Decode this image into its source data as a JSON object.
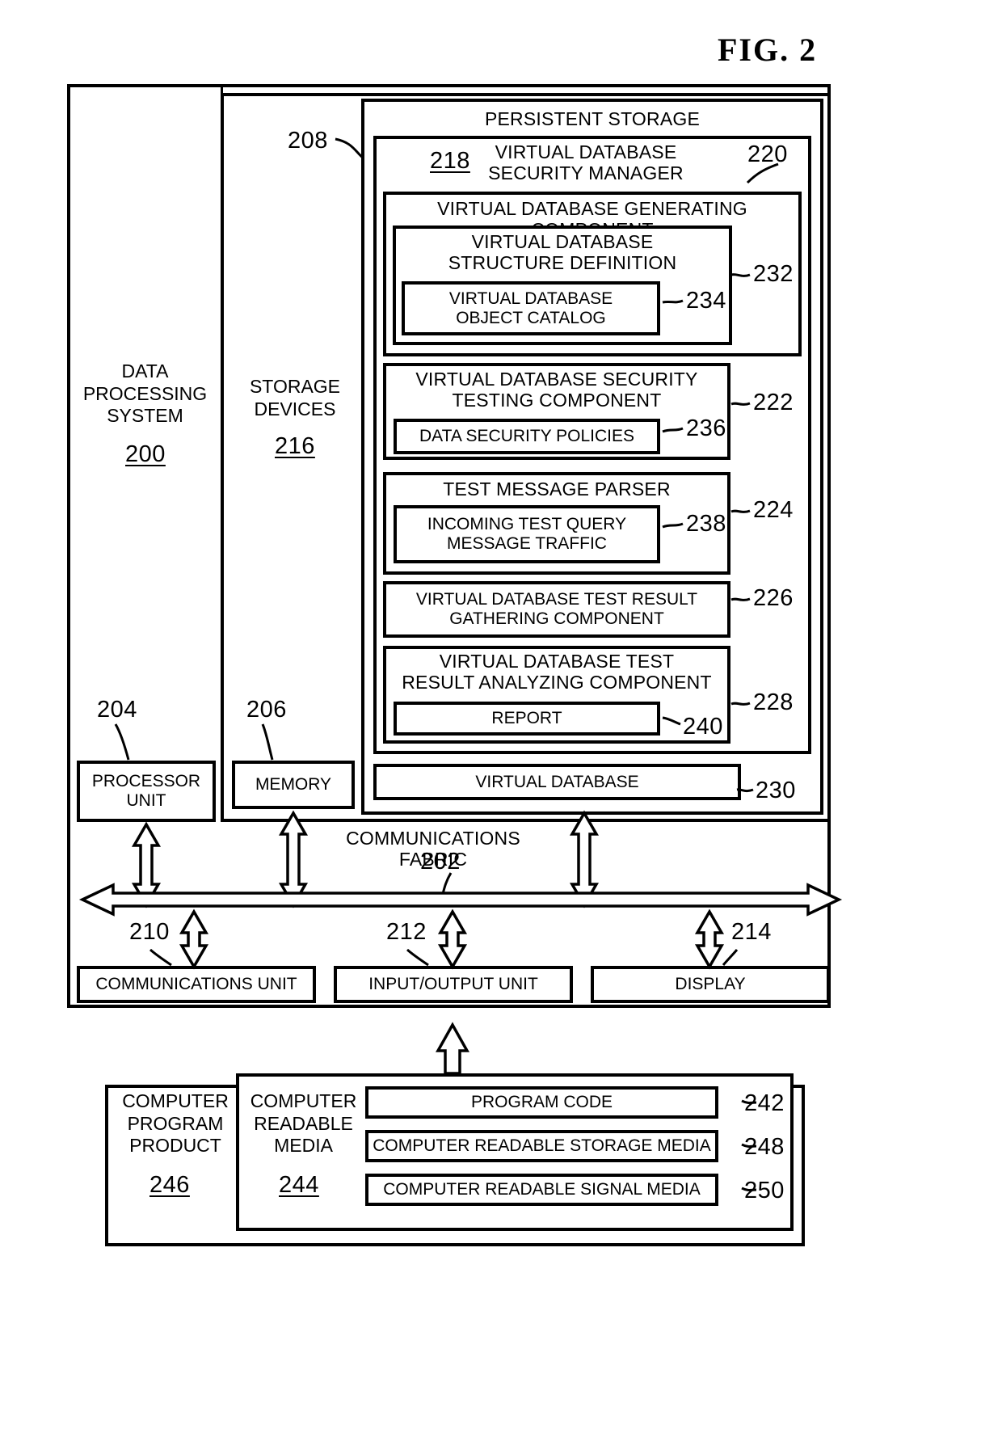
{
  "figure": {
    "title": "FIG. 2"
  },
  "system": {
    "name": "DATA\nPROCESSING\nSYSTEM",
    "ref": "200"
  },
  "storage_devices": {
    "name": "STORAGE\nDEVICES",
    "ref": "216"
  },
  "persistent_storage": {
    "name": "PERSISTENT STORAGE",
    "ref": "208"
  },
  "security_manager": {
    "name": "VIRTUAL DATABASE\nSECURITY MANAGER",
    "ref": "218"
  },
  "components": [
    {
      "name": "VIRTUAL DATABASE GENERATING COMPONENT",
      "ref": "220",
      "children": [
        {
          "name": "VIRTUAL DATABASE\nSTRUCTURE DEFINITION",
          "ref": "232",
          "children": [
            {
              "name": "VIRTUAL DATABASE\nOBJECT CATALOG",
              "ref": "234"
            }
          ]
        }
      ]
    },
    {
      "name": "VIRTUAL DATABASE SECURITY\nTESTING COMPONENT",
      "ref": "222",
      "children": [
        {
          "name": "DATA SECURITY POLICIES",
          "ref": "236"
        }
      ]
    },
    {
      "name": "TEST MESSAGE PARSER",
      "ref": "224",
      "children": [
        {
          "name": "INCOMING TEST QUERY\nMESSAGE TRAFFIC",
          "ref": "238"
        }
      ]
    },
    {
      "name": "VIRTUAL DATABASE TEST RESULT\nGATHERING COMPONENT",
      "ref": "226",
      "children": []
    },
    {
      "name": "VIRTUAL DATABASE TEST\nRESULT ANALYZING COMPONENT",
      "ref": "228",
      "children": [
        {
          "name": "REPORT",
          "ref": "240"
        }
      ]
    }
  ],
  "virtual_database": {
    "name": "VIRTUAL DATABASE",
    "ref": "230"
  },
  "processor_unit": {
    "name": "PROCESSOR\nUNIT",
    "ref": "204"
  },
  "memory": {
    "name": "MEMORY",
    "ref": "206"
  },
  "communications_fabric": {
    "name": "COMMUNICATIONS FABRIC",
    "ref": "202"
  },
  "bottom_units": [
    {
      "name": "COMMUNICATIONS UNIT",
      "ref": "210"
    },
    {
      "name": "INPUT/OUTPUT UNIT",
      "ref": "212"
    },
    {
      "name": "DISPLAY",
      "ref": "214"
    }
  ],
  "computer_program_product": {
    "name": "COMPUTER\nPROGRAM\nPRODUCT",
    "ref": "246"
  },
  "computer_readable_media": {
    "name": "COMPUTER\nREADABLE\nMEDIA",
    "ref": "244"
  },
  "media_items": [
    {
      "name": "PROGRAM CODE",
      "ref": "242"
    },
    {
      "name": "COMPUTER READABLE STORAGE MEDIA",
      "ref": "248"
    },
    {
      "name": "COMPUTER READABLE SIGNAL MEDIA",
      "ref": "250"
    }
  ]
}
